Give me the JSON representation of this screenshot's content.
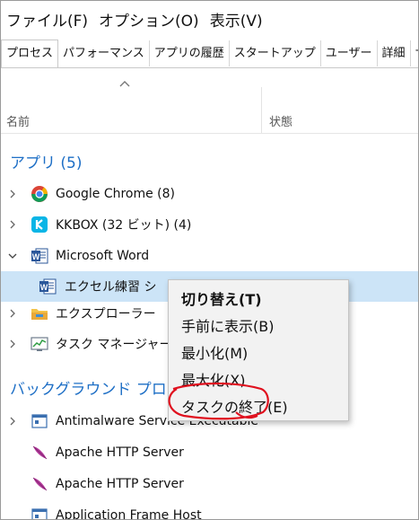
{
  "menubar": {
    "file": "ファイル(F)",
    "options": "オプション(O)",
    "view": "表示(V)"
  },
  "tabs": [
    "プロセス",
    "パフォーマンス",
    "アプリの履歴",
    "スタートアップ",
    "ユーザー",
    "詳細",
    "サービス"
  ],
  "columns": {
    "name": "名前",
    "status": "状態"
  },
  "groups": {
    "apps": "アプリ (5)",
    "background": "バックグラウンド プロ"
  },
  "apps": [
    {
      "label": "Google Chrome (8)",
      "icon": "chrome-icon"
    },
    {
      "label": "KKBOX (32 ビット) (4)",
      "icon": "kkbox-icon"
    },
    {
      "label": "Microsoft Word",
      "icon": "word-icon"
    },
    {
      "label": "エクセル練習 シ",
      "icon": "word-doc-icon"
    },
    {
      "label": "エクスプローラー",
      "icon": "explorer-icon"
    },
    {
      "label": "タスク マネージャー",
      "icon": "task-manager-icon"
    }
  ],
  "background": [
    {
      "label": "Antimalware Service Executable",
      "icon": "service-icon"
    },
    {
      "label": "Apache HTTP Server",
      "icon": "apache-feather-icon"
    },
    {
      "label": "Apache HTTP Server",
      "icon": "apache-feather-icon"
    },
    {
      "label": "Application Frame Host",
      "icon": "service-icon"
    }
  ],
  "context_menu": [
    "切り替え(T)",
    "手前に表示(B)",
    "最小化(M)",
    "最大化(X)",
    "タスクの終了(E)"
  ],
  "colors": {
    "group_title": "#1e6fc6",
    "selection": "#cce4f7",
    "annotation": "#e0101e"
  }
}
